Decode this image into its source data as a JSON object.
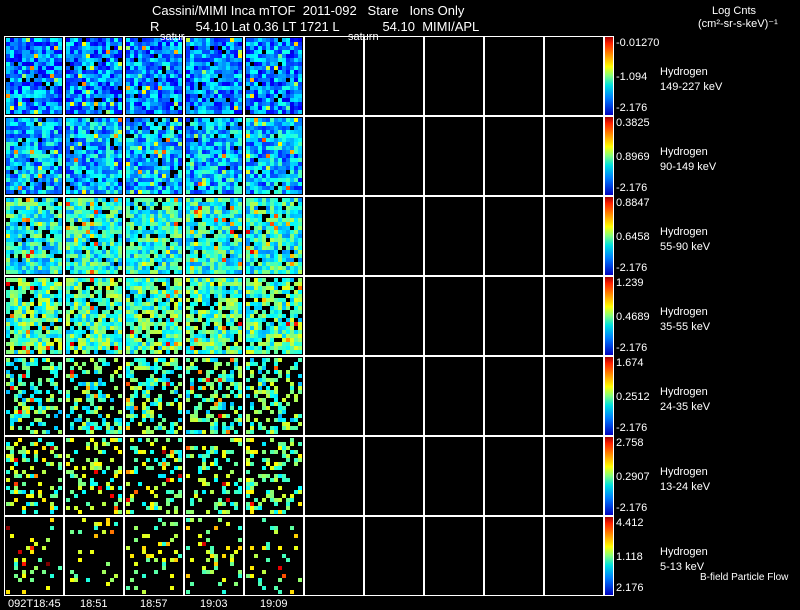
{
  "header": {
    "line1": "Cassini/MIMI Inca mTOF  2011-092   Stare   Ions Only",
    "line2": "R          54.10 Lat 0.36 LT 1721 L            54.10  MIMI/APL",
    "overlay_left": "satur",
    "overlay_mid": "saturn"
  },
  "units": {
    "line1": "Log Cnts",
    "line2": "(cm²-sr-s-keV)⁻¹"
  },
  "footer_note": "B-field Particle Flow",
  "chart_data": {
    "type": "heatmap",
    "title": "Cassini/MIMI Inca mTOF 2011-092 Stare Ions Only",
    "x_ticks": [
      "092T18:45",
      "18:51",
      "18:57",
      "19:03",
      "19:09"
    ],
    "rows": [
      {
        "species": "Hydrogen",
        "energy": "149-227 keV",
        "max": "-0.01270",
        "mid": "-1.094",
        "min": "-2.176",
        "fill": 0.95,
        "level": 0.25
      },
      {
        "species": "Hydrogen",
        "energy": "90-149 keV",
        "max": "0.3825",
        "mid": "0.8969",
        "min": "-2.176",
        "fill": 0.95,
        "level": 0.3
      },
      {
        "species": "Hydrogen",
        "energy": "55-90 keV",
        "max": "0.8847",
        "mid": "0.6458",
        "min": "-2.176",
        "fill": 0.92,
        "level": 0.4
      },
      {
        "species": "Hydrogen",
        "energy": "35-55 keV",
        "max": "1.239",
        "mid": "0.4689",
        "min": "-2.176",
        "fill": 0.85,
        "level": 0.45
      },
      {
        "species": "Hydrogen",
        "energy": "24-35 keV",
        "max": "1.674",
        "mid": "0.2512",
        "min": "-2.176",
        "fill": 0.45,
        "level": 0.45
      },
      {
        "species": "Hydrogen",
        "energy": "13-24 keV",
        "max": "2.758",
        "mid": "0.2907",
        "min": "-2.176",
        "fill": 0.3,
        "level": 0.5
      },
      {
        "species": "Hydrogen",
        "energy": "5-13 keV",
        "max": "4.412",
        "mid": "1.118",
        "min": "2.176",
        "fill": 0.12,
        "level": 0.55
      }
    ],
    "filled_columns": 5,
    "total_columns": 10
  }
}
